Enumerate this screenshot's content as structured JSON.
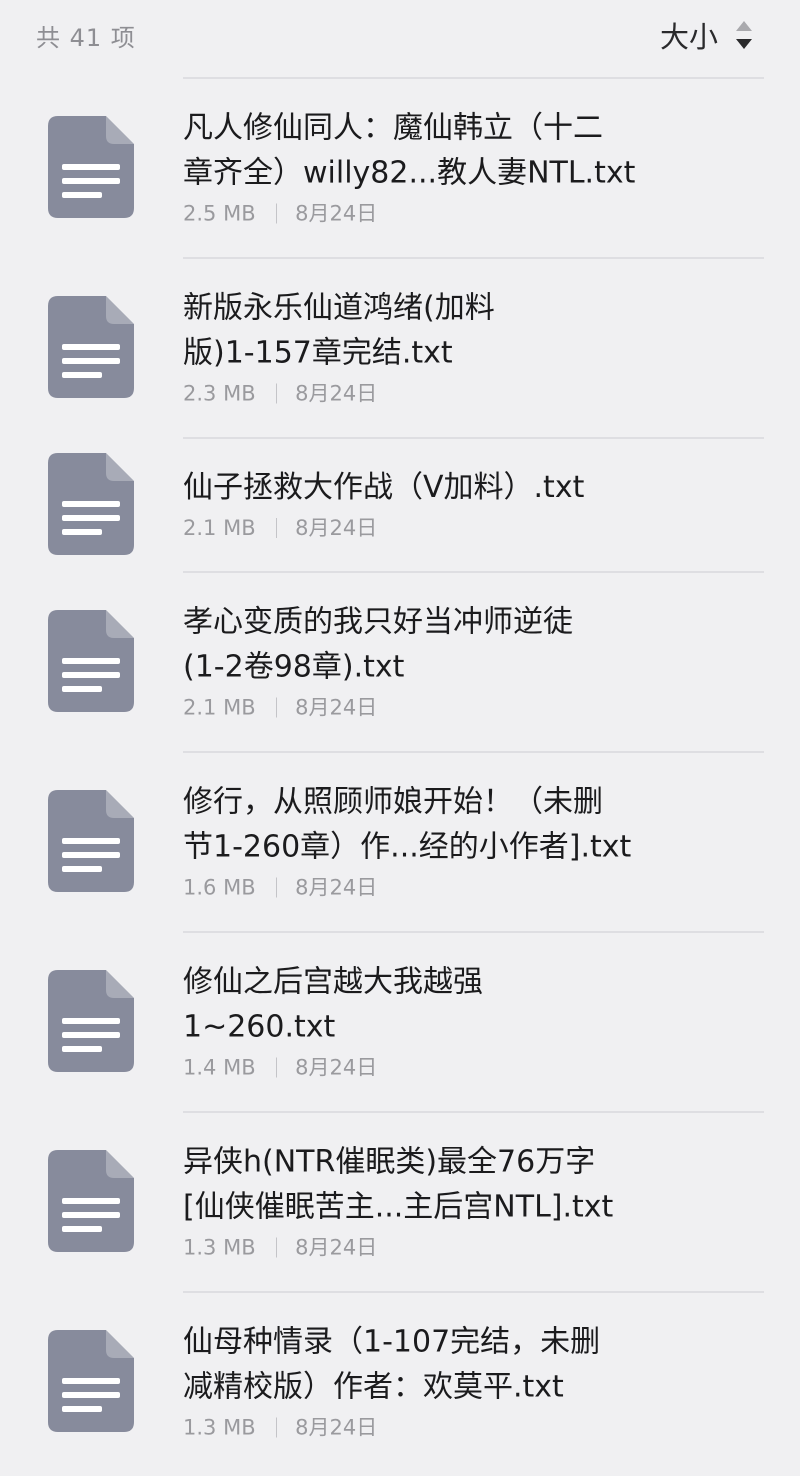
{
  "header": {
    "count_label": "共 41 项",
    "sort_label": "大小",
    "sort_icon": "sort-updown-icon"
  },
  "colors": {
    "background": "#f0f0f2",
    "file_icon": "#878b9c",
    "title_text": "#1b1b1d",
    "meta_text": "#9a9a9e"
  },
  "files": [
    {
      "name_line1": "凡人修仙同人：魔仙韩立（十二",
      "name_line2": "章齐全）willy82...教人妻NTL.txt",
      "size": "2.5 MB",
      "date": "8月24日",
      "icon": "document-icon"
    },
    {
      "name_line1": "新版永乐仙道鸿绪(加料",
      "name_line2": "版)1-157章完结.txt",
      "size": "2.3 MB",
      "date": "8月24日",
      "icon": "document-icon"
    },
    {
      "name_line1": "仙子拯救大作战（V加料）.txt",
      "name_line2": "",
      "size": "2.1 MB",
      "date": "8月24日",
      "icon": "document-icon"
    },
    {
      "name_line1": "孝心变质的我只好当冲师逆徒",
      "name_line2": "(1-2卷98章).txt",
      "size": "2.1 MB",
      "date": "8月24日",
      "icon": "document-icon"
    },
    {
      "name_line1": "修行，从照顾师娘开始！（未删",
      "name_line2": "节1-260章）作...经的小作者].txt",
      "size": "1.6 MB",
      "date": "8月24日",
      "icon": "document-icon"
    },
    {
      "name_line1": "修仙之后宫越大我越强",
      "name_line2": "1~260.txt",
      "size": "1.4 MB",
      "date": "8月24日",
      "icon": "document-icon"
    },
    {
      "name_line1": "异侠h(NTR催眠类)最全76万字",
      "name_line2": "[仙侠催眠苦主...主后宫NTL].txt",
      "size": "1.3 MB",
      "date": "8月24日",
      "icon": "document-icon"
    },
    {
      "name_line1": "仙母种情录（1-107完结，未删",
      "name_line2": "减精校版）作者：欢莫平.txt",
      "size": "1.3 MB",
      "date": "8月24日",
      "icon": "document-icon"
    }
  ]
}
